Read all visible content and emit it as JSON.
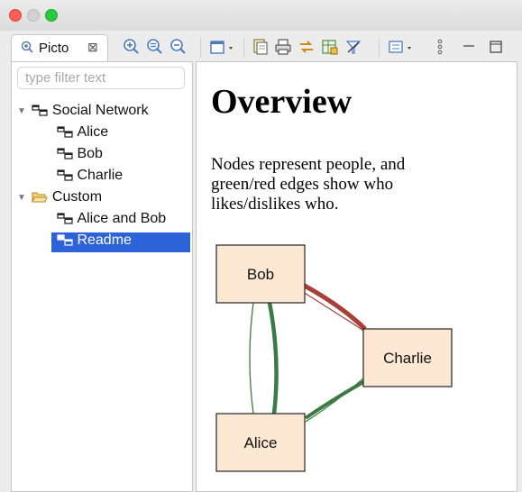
{
  "window": {
    "traffic_lights": [
      "close",
      "minimize",
      "zoom"
    ]
  },
  "tab": {
    "label": "Picto",
    "close_glyph": "⊠"
  },
  "toolbar": {
    "buttons": [
      "zoom-in-icon",
      "zoom-reset-icon",
      "zoom-out-icon",
      "window-dropdown-icon",
      "copy-icon",
      "print-icon",
      "sync-icon",
      "export-icon",
      "filter-icon",
      "view-menu-icon",
      "more-icon",
      "minimize-icon",
      "maximize-icon"
    ]
  },
  "filter": {
    "placeholder": "type filter text"
  },
  "tree": {
    "items": [
      {
        "label": "Social Network",
        "type": "group",
        "expanded": true
      },
      {
        "label": "Alice",
        "type": "node"
      },
      {
        "label": "Bob",
        "type": "node"
      },
      {
        "label": "Charlie",
        "type": "node"
      },
      {
        "label": "Custom",
        "type": "folder",
        "expanded": true
      },
      {
        "label": "Alice and Bob",
        "type": "node"
      },
      {
        "label": "Readme",
        "type": "node",
        "selected": true
      }
    ]
  },
  "content": {
    "heading": "Overview",
    "paragraph": "Nodes represent people, and green/red edges show who likes/dislikes who.",
    "graph": {
      "nodes": [
        "Bob",
        "Charlie",
        "Alice"
      ],
      "colors": {
        "node_fill": "#fde8d4",
        "like_edge": "#3b7a44",
        "dislike_edge": "#a8403a"
      }
    }
  }
}
